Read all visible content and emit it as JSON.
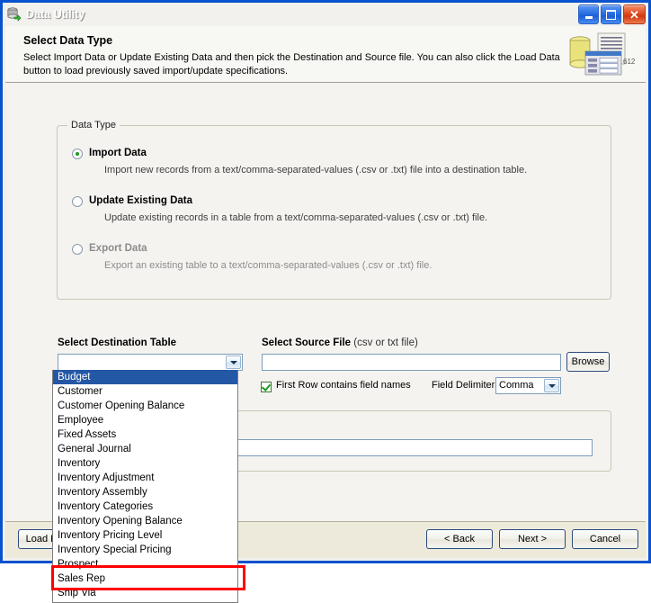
{
  "window": {
    "title": "Data Utility",
    "icon": "database-import-icon",
    "controls": {
      "minimize": "minimize-icon",
      "maximize": "maximize-icon",
      "close": "close-icon"
    }
  },
  "header": {
    "title": "Select Data Type",
    "description": "Select Import Data or Update Existing Data and then pick the Destination and Source file.  You can also click the Load Data button to load previously saved import/update specifications.",
    "icon": "database-documents-icon",
    "icon_number": "612"
  },
  "data_type": {
    "legend": "Data Type",
    "options": [
      {
        "label": "Import Data",
        "description": "Import new records from a text/comma-separated-values (.csv or .txt) file into a destination table.",
        "selected": true,
        "disabled": false
      },
      {
        "label": "Update Existing Data",
        "description": "Update existing records in a table from a text/comma-separated-values (.csv or .txt) file.",
        "selected": false,
        "disabled": false
      },
      {
        "label": "Export Data",
        "description": "Export an existing table to a text/comma-separated-values (.csv or .txt) file.",
        "selected": false,
        "disabled": true
      }
    ]
  },
  "destination": {
    "label": "Select Destination Table",
    "value": "",
    "expanded": true,
    "options": [
      "Budget",
      "Customer",
      "Customer Opening Balance",
      "Employee",
      "Fixed Assets",
      "General Journal",
      "Inventory",
      "Inventory Adjustment",
      "Inventory Assembly",
      "Inventory Categories",
      "Inventory Opening Balance",
      "Inventory Pricing Level",
      "Inventory Special Pricing",
      "Prospect",
      "Sales Rep",
      "Ship Via"
    ],
    "highlighted_option": "Budget",
    "annotated_option": "Sales Rep"
  },
  "source": {
    "label": "Select Source File",
    "label_note": "(csv or txt file)",
    "value": "",
    "browse_label": "Browse",
    "first_row_label": "First Row contains field names",
    "first_row_checked": true,
    "delimiter_label": "Field Delimiter",
    "delimiter_value": "Comma"
  },
  "lower_panel": {
    "value": ""
  },
  "footer": {
    "load_label": "Load Data",
    "back_label": "< Back",
    "next_label": "Next >",
    "cancel_label": "Cancel"
  },
  "colors": {
    "titlebar": "#0A52CE",
    "selection": "#2457A5",
    "annotation": "#FF0000",
    "body": "#F4F3F0",
    "footer": "#EDEADB"
  }
}
